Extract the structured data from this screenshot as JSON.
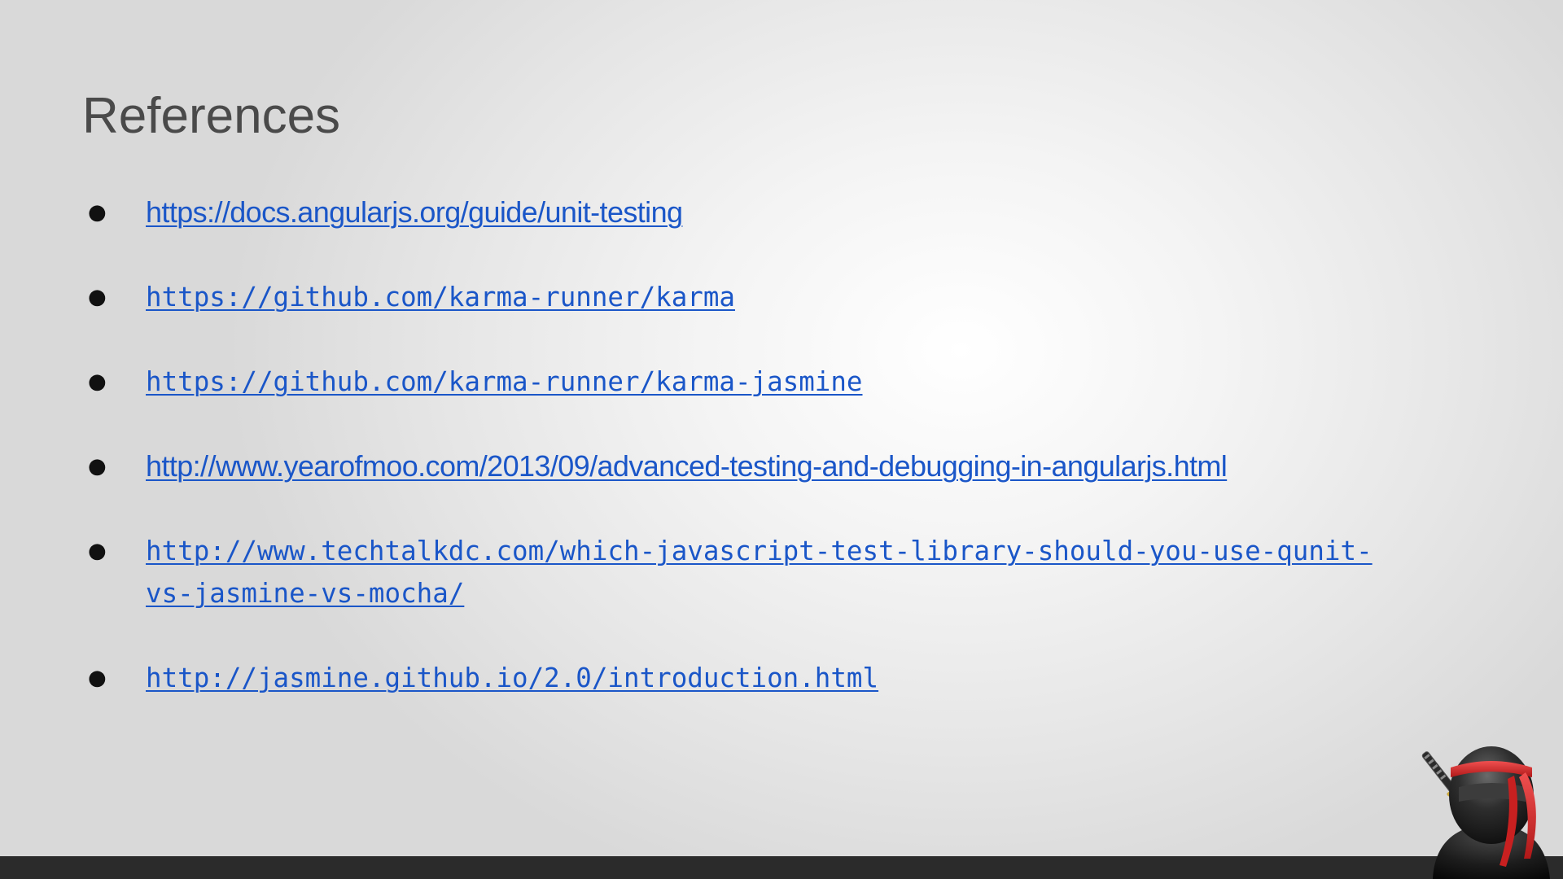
{
  "slide": {
    "title": "References",
    "references": [
      {
        "bullet": "●",
        "url": "https://docs.angularjs.org/guide/unit-testing",
        "font": "sans"
      },
      {
        "bullet": "●",
        "url": "https://github.com/karma-runner/karma",
        "font": "mono"
      },
      {
        "bullet": "●",
        "url": "https://github.com/karma-runner/karma-jasmine",
        "font": "mono"
      },
      {
        "bullet": "●",
        "url": "http://www.yearofmoo.com/2013/09/advanced-testing-and-debugging-in-angularjs.html",
        "font": "sans"
      },
      {
        "bullet": "●",
        "url": "http://www.techtalkdc.com/which-javascript-test-library-should-you-use-qunit-vs-jasmine-vs-mocha/",
        "font": "mono"
      },
      {
        "bullet": "●",
        "url": "http://jasmine.github.io/2.0/introduction.html",
        "font": "mono"
      }
    ]
  },
  "colors": {
    "link": "#1a56c8",
    "title": "#4a4a4a",
    "footer_bar": "#2b2b2b",
    "ninja_band": "#d42a2a"
  },
  "icons": {
    "mascot": "ninja-mascot-icon"
  }
}
